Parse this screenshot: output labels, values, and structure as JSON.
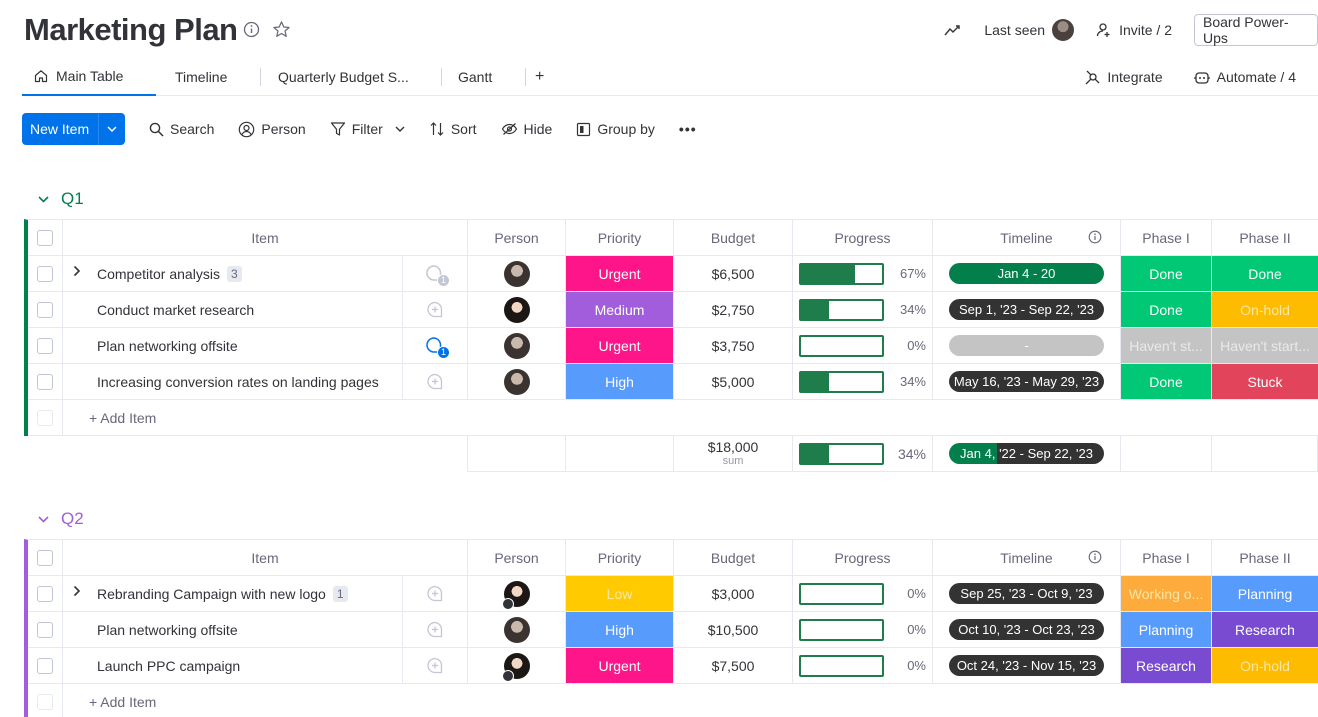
{
  "header": {
    "title": "Marketing Plan",
    "last_seen": "Last seen",
    "invite": "Invite / 2",
    "power_ups": "Board Power-Ups"
  },
  "tabs": [
    {
      "label": "Main Table",
      "active": true
    },
    {
      "label": "Timeline"
    },
    {
      "label": "Quarterly Budget S..."
    },
    {
      "label": "Gantt"
    },
    {
      "label": "+"
    }
  ],
  "tabs_right": {
    "integrate": "Integrate",
    "automate": "Automate / 4"
  },
  "toolbar": {
    "new_item": "New Item",
    "search": "Search",
    "person": "Person",
    "filter": "Filter",
    "sort": "Sort",
    "hide": "Hide",
    "group_by": "Group by",
    "more": "•••"
  },
  "columns": {
    "item": "Item",
    "person": "Person",
    "priority": "Priority",
    "budget": "Budget",
    "progress": "Progress",
    "timeline": "Timeline",
    "phase1": "Phase I",
    "phase2": "Phase II"
  },
  "colors": {
    "urgent": "#ff158a",
    "medium": "#a25ddc",
    "high": "#579bfc",
    "low": "#ffcb00",
    "done": "#00c875",
    "onhold": "#fdbc00",
    "stuck": "#e2445c",
    "planning": "#579bfc",
    "research": "#784bd1",
    "working": "#fdab3d",
    "empty": "#c4c4c4",
    "q1": "#037f4c",
    "q2": "#a25ddc",
    "primary": "#0073ea"
  },
  "groups": [
    {
      "title": "Q1",
      "rows": [
        {
          "item": "Competitor analysis",
          "subitems": "3",
          "priority": "Urgent",
          "prio_key": "urgent",
          "budget": "$6,500",
          "progress": 0.67,
          "progress_label": "67%",
          "timeline": "Jan 4 - 20",
          "timeline_style": "green",
          "phase1": "Done",
          "p1_key": "done",
          "phase2": "Done",
          "p2_key": "done",
          "conv": "count",
          "conv_count": "1",
          "av": "a"
        },
        {
          "item": "Conduct market research",
          "priority": "Medium",
          "prio_key": "medium",
          "budget": "$2,750",
          "progress": 0.34,
          "progress_label": "34%",
          "timeline": "Sep 1, '23 - Sep 22, '23",
          "phase1": "Done",
          "p1_key": "done",
          "phase2": "On-hold",
          "p2_key": "onhold",
          "conv": "add",
          "av": "b"
        },
        {
          "item": "Plan networking offsite",
          "priority": "Urgent",
          "prio_key": "urgent",
          "budget": "$3,750",
          "progress": 0.0,
          "progress_label": "0%",
          "timeline": "-",
          "timeline_style": "empty",
          "phase1": "Haven't st...",
          "p1_key": "empty",
          "phase2": "Haven't start...",
          "p2_key": "empty",
          "conv": "blue",
          "conv_count": "1",
          "av": "a"
        },
        {
          "item": "Increasing conversion rates on landing pages",
          "priority": "High",
          "prio_key": "high",
          "budget": "$5,000",
          "progress": 0.34,
          "progress_label": "34%",
          "timeline": "May 16, '23 - May 29, '23",
          "phase1": "Done",
          "p1_key": "done",
          "phase2": "Stuck",
          "p2_key": "stuck",
          "conv": "add",
          "av": "a"
        }
      ],
      "add_item": "+ Add Item",
      "summary": {
        "budget": "$18,000",
        "budget_label": "sum",
        "progress": 0.34,
        "progress_label": "34%",
        "timeline": "Jan 4, '22 - Sep 22, '23"
      }
    },
    {
      "title": "Q2",
      "rows": [
        {
          "item": "Rebranding Campaign with new logo",
          "subitems": "1",
          "priority": "Low",
          "prio_key": "low",
          "budget": "$3,000",
          "progress": 0.0,
          "progress_label": "0%",
          "timeline": "Sep 25, '23 - Oct 9, '23",
          "phase1": "Working o...",
          "p1_key": "working",
          "phase2": "Planning",
          "p2_key": "planning",
          "conv": "add",
          "av": "c"
        },
        {
          "item": "Plan networking offsite",
          "priority": "High",
          "prio_key": "high",
          "budget": "$10,500",
          "progress": 0.0,
          "progress_label": "0%",
          "timeline": "Oct 10, '23 - Oct 23, '23",
          "phase1": "Planning",
          "p1_key": "planning",
          "phase2": "Research",
          "p2_key": "research",
          "conv": "add",
          "av": "a"
        },
        {
          "item": "Launch PPC campaign",
          "priority": "Urgent",
          "prio_key": "urgent",
          "budget": "$7,500",
          "progress": 0.0,
          "progress_label": "0%",
          "timeline": "Oct 24, '23 - Nov 15, '23",
          "phase1": "Research",
          "p1_key": "research",
          "phase2": "On-hold",
          "p2_key": "onhold",
          "conv": "add",
          "av": "c"
        }
      ],
      "add_item": "+ Add Item"
    }
  ]
}
